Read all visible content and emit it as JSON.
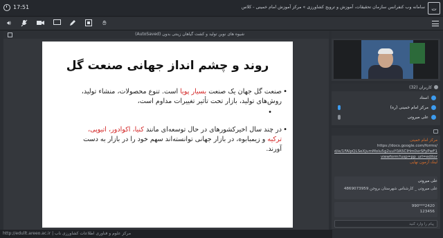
{
  "titlebar": {
    "time": "17:51",
    "title": "سامانه وب کنفرانس سازمان تحقیقات، آموزش و ترویج کشاورزی » مرکز آموزش امام خمینی - کلاس",
    "logo_text": "ت"
  },
  "toolbar": {
    "icons": [
      "speaker-icon",
      "mic-off-icon",
      "camera-icon",
      "screen-icon",
      "pencil-icon",
      "poll-icon",
      "hand-icon",
      "menu-icon"
    ]
  },
  "main": {
    "doc_title": "شیوه های نوین تولید و کشت گیاهان زینتی بدون (AutoSaved)",
    "slide": {
      "title": "روند و چشم انداز جهانی صنعت گل",
      "para1_a": "صنعت گل  جهان یک صنعت ",
      "para1_red": "بسیار پویا",
      "para1_b": " است. تنوع محصولات، منشاء تولید، روش‌های تولید، بازار تحت تأثیر تغییرات مداوم است،",
      "para2_a": "در چند سال اخیرکشورهای در حال توسعه‌ای مانند ",
      "para2_red1": "کنیا، اکوادور، اتیوپی، ترکیه",
      "para2_b": " و زیمبابوه، در بازار جهانی توانسته‌اند سهم خود را در بازار به دست آورند."
    }
  },
  "link_bar": {
    "text": "http://edullt.areeo.ac.ir | مرکز علوم و فناوری اطلاعات کشاورزی ناب"
  },
  "users": {
    "header": "کاربران (32)",
    "list": [
      {
        "name": "استاد"
      },
      {
        "name": "مرکز امام خمینی (ره)"
      },
      {
        "name": "علی میروتی"
      }
    ]
  },
  "chat": {
    "msg1_author": "مرکز امام خمینی",
    "msg1_link1": "https://docs.google.com/forms/",
    "msg1_link2": "d/e/1FAIpQLSeXjumMolu5g2uuY0A5ClHm0xrSFyPwF1wn9xBaL3IQ/",
    "msg1_link3": "viewform?usp=pp_url=editor",
    "msg1_tag": "لینک آزمون نهایی",
    "msg2_author": "علی میروتی",
    "msg2_body": "علی میروتی _ کارشناس شهرستان بروجن 4869073959",
    "msg3_body": "990***2420",
    "msg3_body2": "123456",
    "input_placeholder": "پیام را وارد کنید"
  }
}
